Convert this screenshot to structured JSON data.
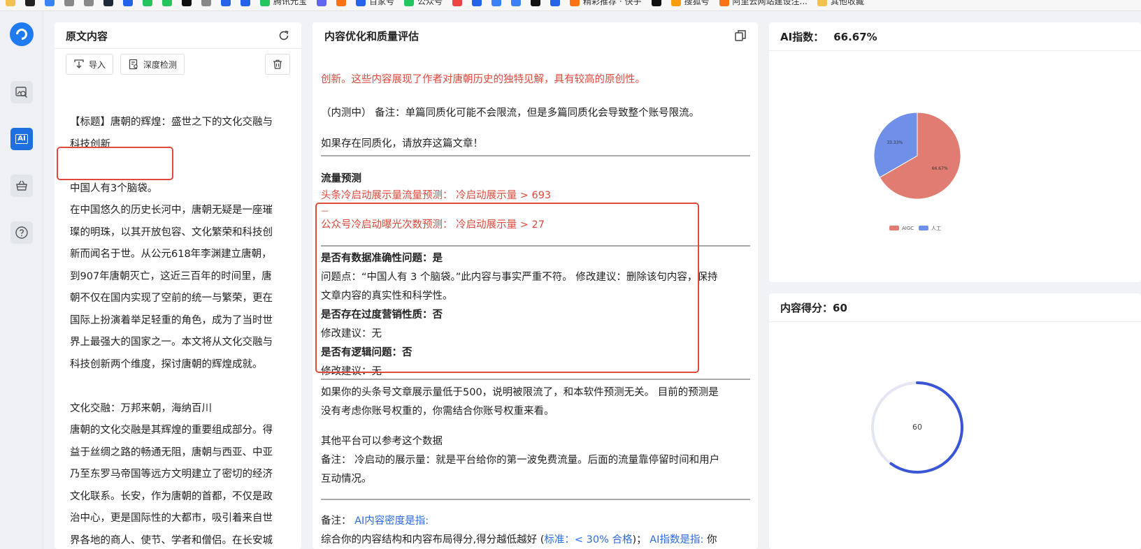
{
  "bookmarks": [
    {
      "label": "",
      "color": "#f2c14e"
    },
    {
      "label": "",
      "color": "#222222"
    },
    {
      "label": "",
      "color": "#3b82f6"
    },
    {
      "label": "",
      "color": "#888888"
    },
    {
      "label": "",
      "color": "#888888"
    },
    {
      "label": "",
      "color": "#1f2937"
    },
    {
      "label": "",
      "color": "#2563eb"
    },
    {
      "label": "",
      "color": "#22c55e"
    },
    {
      "label": "",
      "color": "#22c55e"
    },
    {
      "label": "",
      "color": "#111111"
    },
    {
      "label": "",
      "color": "#888888"
    },
    {
      "label": "",
      "color": "#2563eb"
    },
    {
      "label": "",
      "color": "#2563eb"
    },
    {
      "label": "腾讯元宝",
      "color": "#22c55e"
    },
    {
      "label": "",
      "color": "#6366f1"
    },
    {
      "label": "",
      "color": "#f97316"
    },
    {
      "label": "百家号",
      "color": "#2563eb"
    },
    {
      "label": "公众号",
      "color": "#22c55e"
    },
    {
      "label": "",
      "color": "#ef4444"
    },
    {
      "label": "",
      "color": "#2563eb"
    },
    {
      "label": "",
      "color": "#3b82f6"
    },
    {
      "label": "",
      "color": "#3b82f6"
    },
    {
      "label": "",
      "color": "#111111"
    },
    {
      "label": "",
      "color": "#2563eb"
    },
    {
      "label": "精彩推荐 · 快手",
      "color": "#f97316"
    },
    {
      "label": "",
      "color": "#111111"
    },
    {
      "label": "搜狐号",
      "color": "#f59e0b"
    },
    {
      "label": "阿里云网站建设注...",
      "color": "#f97316"
    },
    {
      "label": "其他收藏",
      "color": "#f2c14e"
    }
  ],
  "p1": {
    "title": "原文内容",
    "import_label": "导入",
    "detect_label": "深度检测",
    "lines": [
      "【标题】唐朝的辉煌：盛世之下的文化交融与",
      "科技创新",
      "",
      "中国人有3个脑袋。",
      "在中国悠久的历史长河中，唐朝无疑是一座璀",
      "璨的明珠，以其开放包容、文化繁荣和科技创",
      "新而闻名于世。从公元618年李渊建立唐朝，",
      "到907年唐朝灭亡，这近三百年的时间里，唐",
      "朝不仅在国内实现了空前的统一与繁荣，更在",
      "国际上扮演着举足轻重的角色，成为了当时世",
      "界上最强大的国家之一。本文将从文化交融与",
      "科技创新两个维度，探讨唐朝的辉煌成就。",
      "",
      "文化交融：万邦来朝，海纳百川",
      "唐朝的文化交融是其辉煌的重要组成部分。得",
      "益于丝绸之路的畅通无阻，唐朝与西亚、中亚",
      "乃至东罗马帝国等远方文明建立了密切的经济",
      "文化联系。长安，作为唐朝的首都，不仅是政",
      "治中心，更是国际性的大都市，吸引着来自世",
      "界各地的商人、使节、学者和僧侣。在长安城"
    ]
  },
  "p2": {
    "title": "内容优化和质量评估",
    "l1": "创新。这些内容展现了作者对唐朝历史的独特见解，具有较高的原创性。",
    "l2": "（内测中） 备注：单篇同质化可能不会限流，但是多篇同质化会导致整个账号限流。",
    "l3": "如果存在同质化，请放弃这篇文章！",
    "l4": "流量预测",
    "l5": "头条冷启动展示量流量预测： 冷启动展示量 > 693",
    "l5b": "—",
    "l6": "公众号冷启动曝光次数预测： 冷启动展示量 > 27",
    "l7": "是否有数据准确性问题：是",
    "l8": "问题点：“中国人有 3 个脑袋。”此内容与事实严重不符。 修改建议：删除该句内容，保持",
    "l9": "文章内容的真实性和科学性。",
    "l10": "是否存在过度营销性质：否",
    "l11": "修改建议：无",
    "l12": "是否有逻辑问题：否",
    "l13": "修改建议：无",
    "l14": "如果你的头条号文章展示量低于500，说明被限流了，和本软件预测无关。 目前的预测是",
    "l15": "没有考虑你账号权重的，你需结合你账号权重来看。",
    "l16": "其他平台可以参考这个数据",
    "l17": "备注： 冷启动的展示量：就是平台给你的第一波免费流量。后面的流量靠停留时间和用户",
    "l18": "互动情况。",
    "l19a": "备注： ",
    "l19b": "AI内容密度是指:",
    "l20a": "综合你的内容结构和内容布局得分,得分越低越好 (",
    "l20b": "标准：< 30% 合格",
    "l20c": ")； ",
    "l20d": "AI指数是指:",
    "l20e": " 你"
  },
  "p3": {
    "title": "AI指数：",
    "value": "66.67%"
  },
  "p4": {
    "title": "内容得分：",
    "value": "60"
  },
  "chart_data": [
    {
      "type": "pie",
      "title": "",
      "slices": [
        {
          "name": "AIGC",
          "value": 66.67,
          "label": "66.67%",
          "color": "#e07c72"
        },
        {
          "name": "人工",
          "value": 33.33,
          "label": "33.33%",
          "color": "#6f8fe8"
        }
      ],
      "legend": "bottom"
    },
    {
      "type": "gauge",
      "value": 60,
      "max": 100,
      "label": "60",
      "color": "#3856d6",
      "track_color": "#e4e6f2"
    }
  ]
}
